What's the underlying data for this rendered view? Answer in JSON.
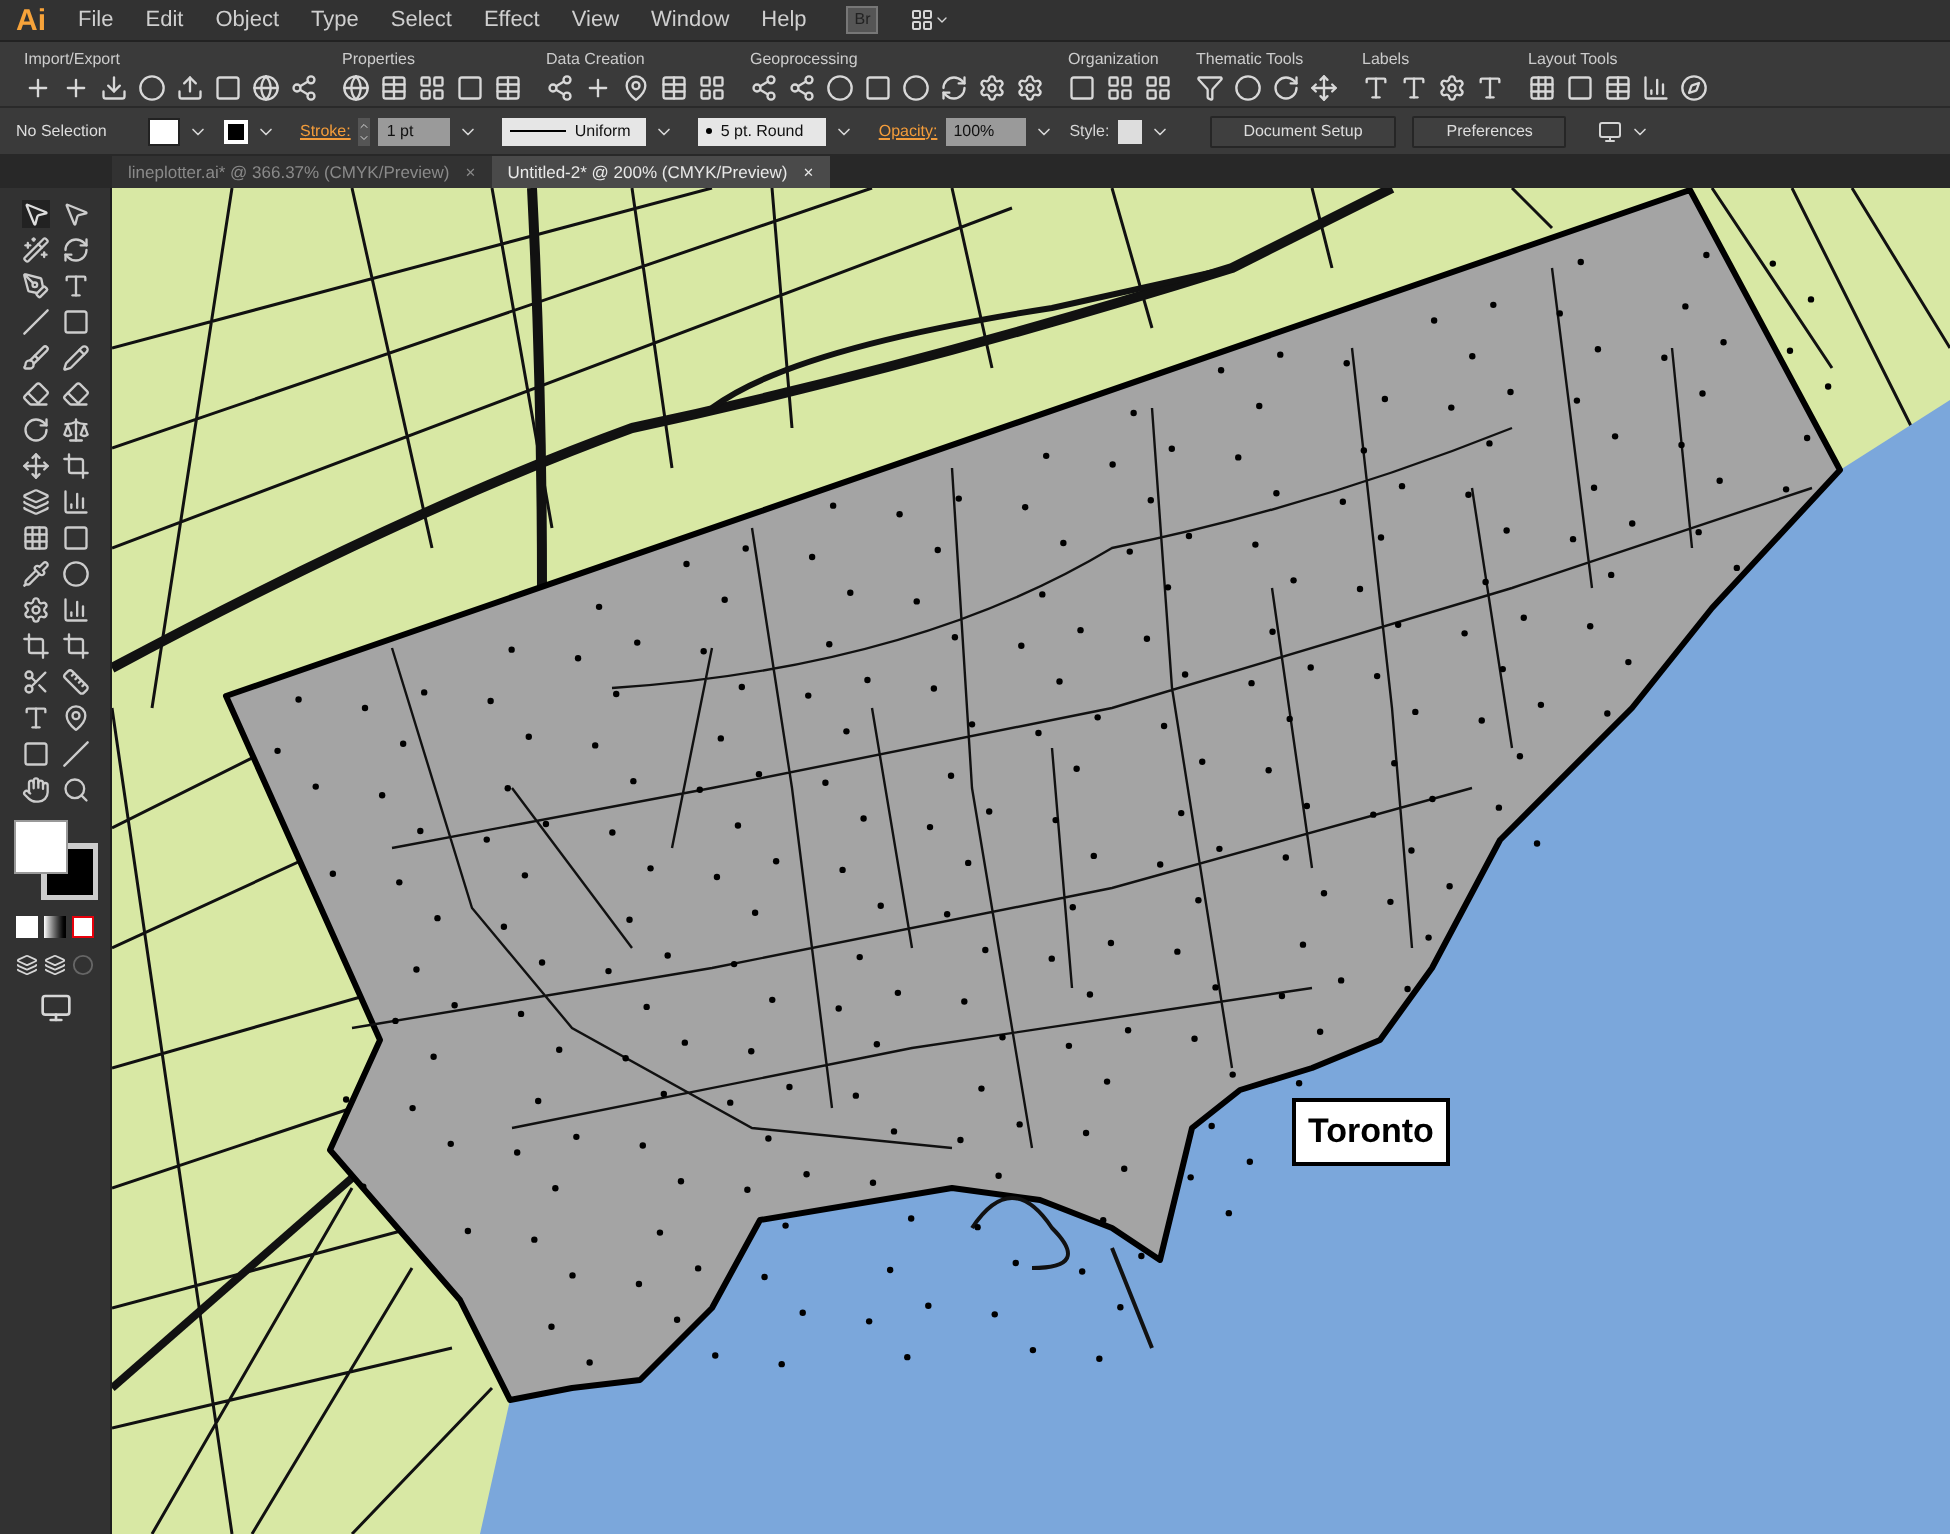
{
  "app_logo": "Ai",
  "menu": [
    "File",
    "Edit",
    "Object",
    "Type",
    "Select",
    "Effect",
    "View",
    "Window",
    "Help"
  ],
  "bridge_button": "Br",
  "toolbar_groups": [
    {
      "label": "Import/Export"
    },
    {
      "label": "Properties"
    },
    {
      "label": "Data Creation"
    },
    {
      "label": "Geoprocessing"
    },
    {
      "label": "Organization"
    },
    {
      "label": "Thematic Tools"
    },
    {
      "label": "Labels"
    },
    {
      "label": "Layout Tools"
    }
  ],
  "control_bar": {
    "selection": "No Selection",
    "stroke_label": "Stroke:",
    "stroke_weight": "1 pt",
    "profile": "Uniform",
    "brush": "5 pt. Round",
    "opacity_label": "Opacity:",
    "opacity": "100%",
    "style_label": "Style:",
    "buttons": [
      "Document Setup",
      "Preferences"
    ]
  },
  "tabs": [
    {
      "label": "lineplotter.ai* @ 366.37% (CMYK/Preview)",
      "selected": false
    },
    {
      "label": "Untitled-2* @ 200% (CMYK/Preview)",
      "selected": true
    }
  ],
  "tab_close": "×",
  "map_label": "Toronto"
}
